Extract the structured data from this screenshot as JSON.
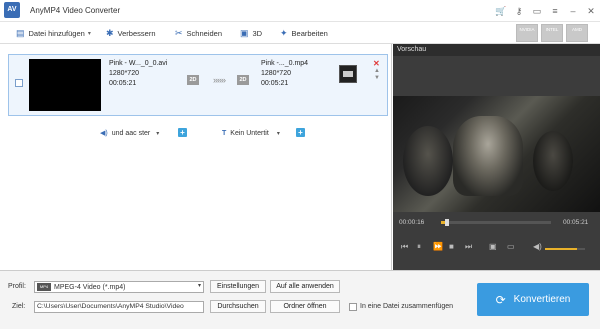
{
  "app": {
    "title": "AnyMP4 Video Converter",
    "logo": "logo-icon"
  },
  "window_controls": [
    "cart-icon",
    "key-icon",
    "feedback-icon",
    "menu-icon",
    "minimize-icon",
    "close-icon"
  ],
  "toolbar": {
    "add_file": "Datei hinzufügen",
    "improve": "Verbessern",
    "cut": "Schneiden",
    "threed": "3D",
    "edit": "Bearbeiten",
    "hw_accel": [
      "NVIDIA",
      "INTEL",
      "AMD"
    ]
  },
  "file": {
    "source_name": "Pink - W..._0_0.avi",
    "source_res": "1280*720",
    "source_dur": "00:05:21",
    "target_name": "Pink -..._0.mp4",
    "target_res": "1280*720",
    "target_dur": "00:05:21",
    "badge_2d": "2D",
    "audio": "und aac ster",
    "subtitle": "Kein Untertit"
  },
  "preview": {
    "label": "Vorschau",
    "current_time": "00:00:16",
    "total_time": "00:05:21",
    "progress": 0.05,
    "volume": 0.8
  },
  "bottom": {
    "profile_label": "Profil:",
    "profile_value": "MPEG-4 Video (*.mp4)",
    "settings": "Einstellungen",
    "apply_all": "Auf alle anwenden",
    "target_label": "Ziel:",
    "target_path": "C:\\Users\\User\\Documents\\AnyMP4 Studio\\Video",
    "browse": "Durchsuchen",
    "open_folder": "Ordner öffnen",
    "merge": "In eine Datei zusammenfügen",
    "convert": "Konvertieren"
  }
}
